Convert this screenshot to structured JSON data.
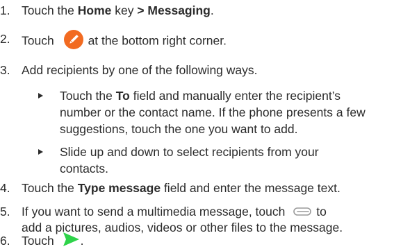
{
  "steps": [
    {
      "number": "1.",
      "parts": [
        "Touch the ",
        "Home",
        " key ",
        "> Messaging",
        "."
      ]
    },
    {
      "number": "2.",
      "before": "Touch",
      "icon": "compose-pencil-icon",
      "after": "at the bottom right corner."
    },
    {
      "number": "3.",
      "text": "Add recipients by one of the following ways.",
      "bullets": [
        {
          "lines": [
            [
              "Touch the ",
              "To",
              " field and manually enter the recipient’s"
            ],
            "number or the contact name. If the phone presents a few",
            "suggestions, touch the one you want to add."
          ]
        },
        {
          "lines": [
            "Slide up and down to select recipients from your",
            "contacts."
          ]
        }
      ]
    },
    {
      "number": "4.",
      "parts": [
        "Touch the ",
        "Type message",
        " field and enter the message text."
      ]
    },
    {
      "number": "5.",
      "line1_before": "If you want to send a multimedia message, touch",
      "icon": "attachment-icon",
      "line1_after": "to",
      "line2": "add a pictures, audios, videos or other files to the message."
    },
    {
      "number": "6.",
      "before": "Touch",
      "icon": "send-icon",
      "after": "."
    }
  ],
  "colors": {
    "text": "#2b2b2b",
    "compose_icon": "#f26b21",
    "send_icon": "#2ed34a",
    "attachment_icon": "#9a9a9a"
  }
}
